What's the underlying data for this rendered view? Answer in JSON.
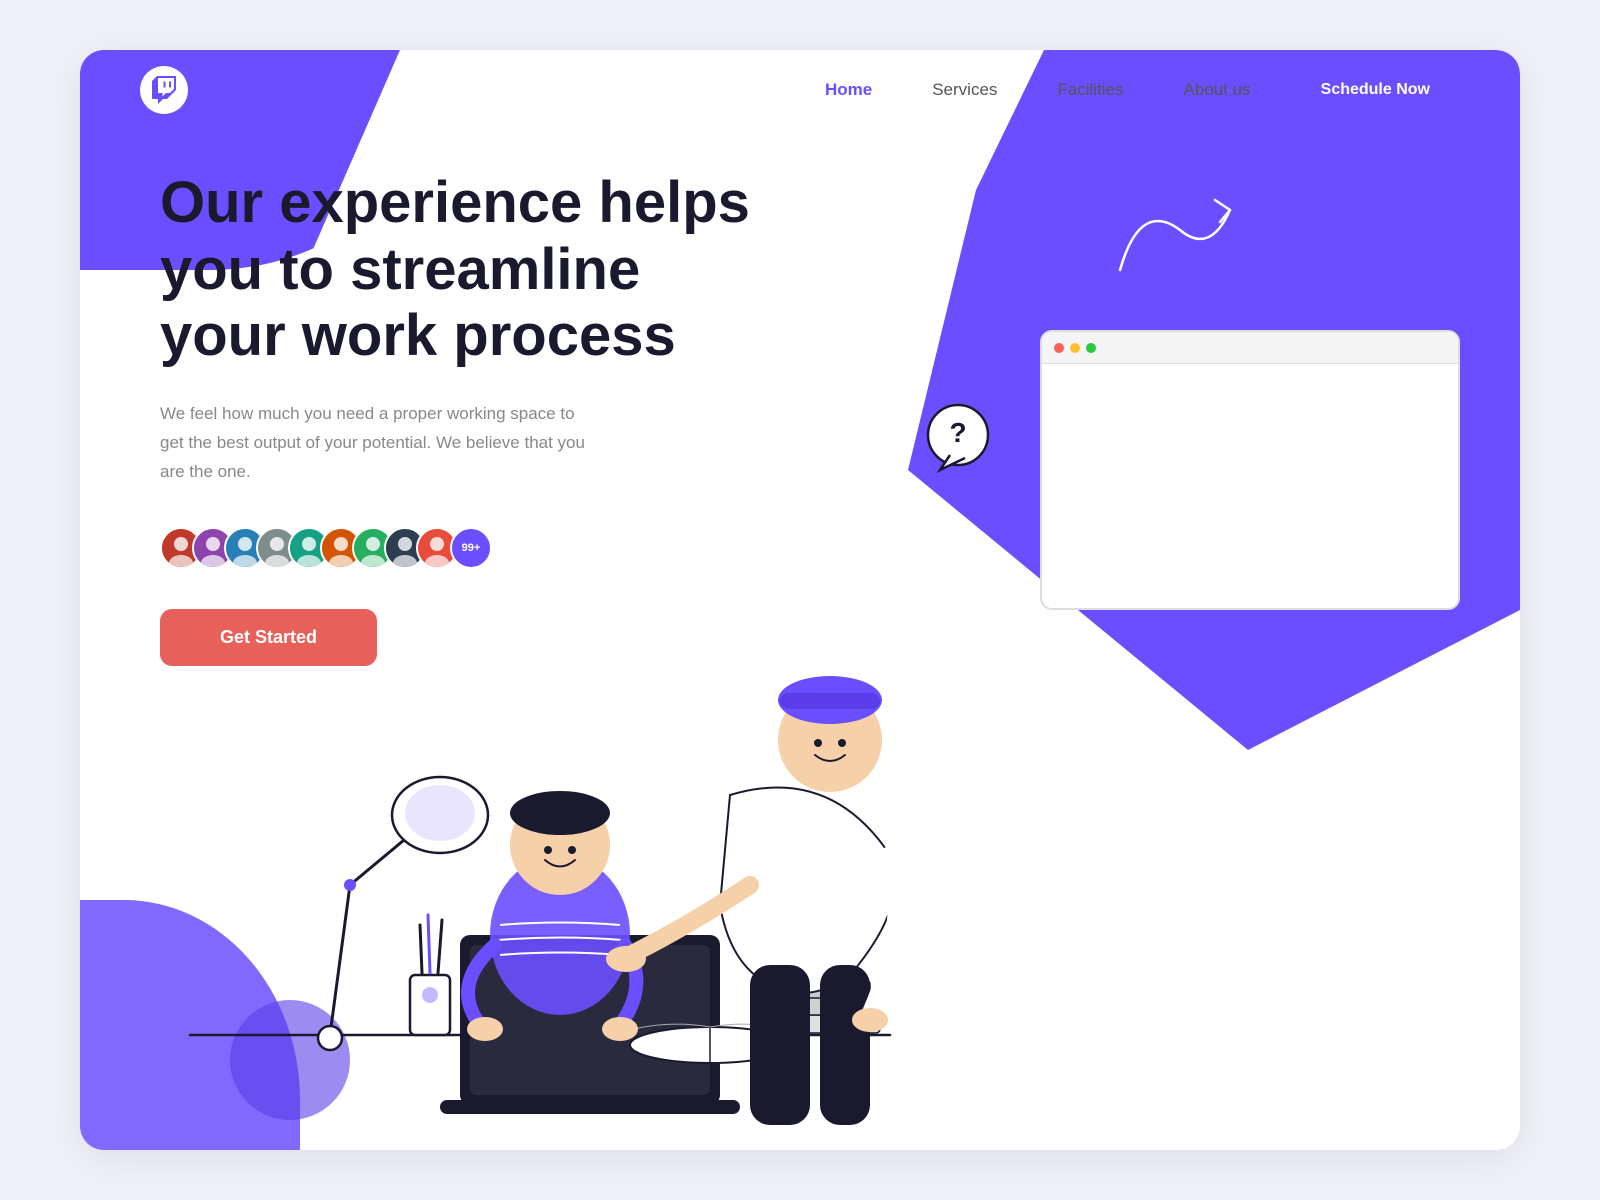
{
  "page": {
    "background_color": "#f0f0f8",
    "card_background": "#ffffff"
  },
  "navbar": {
    "logo_alt": "Twitch-style logo",
    "nav_links": [
      {
        "label": "Home",
        "active": true
      },
      {
        "label": "Services",
        "active": false
      },
      {
        "label": "Facilities",
        "active": false
      },
      {
        "label": "About us",
        "active": false
      }
    ],
    "cta_button": "Schedule Now"
  },
  "hero": {
    "title": "Our experience helps you to streamline your work process",
    "subtitle": "We feel how much you need a proper working space to get the best output of your potential. We believe that you are the one.",
    "avatar_count": "99+",
    "cta_button": "Get Started"
  },
  "colors": {
    "primary": "#6B4EFF",
    "coral": "#E8605A",
    "dark_text": "#1a1a2e",
    "gray_text": "#888888"
  }
}
